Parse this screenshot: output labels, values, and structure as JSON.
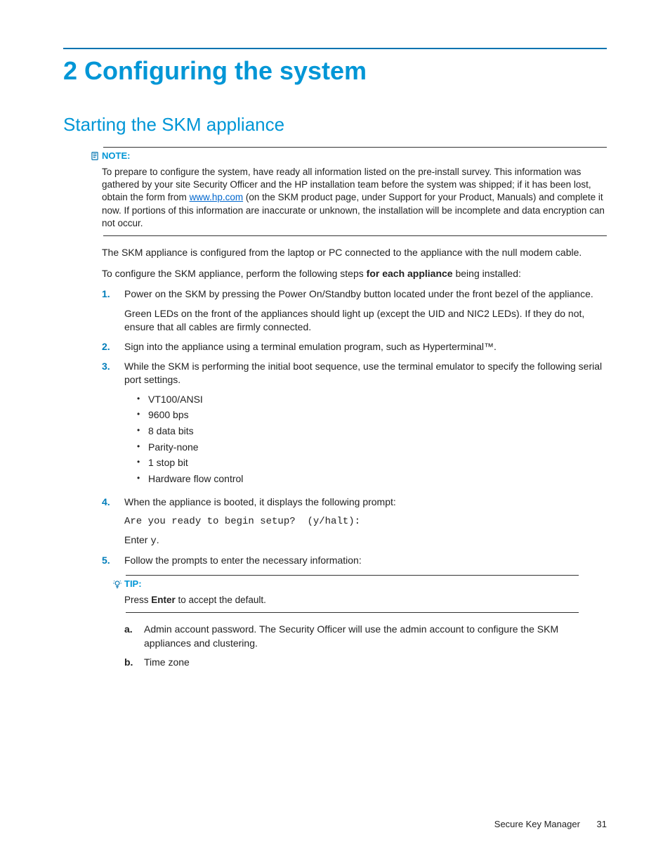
{
  "chapter": {
    "title": "2 Configuring the system"
  },
  "section": {
    "title": "Starting the SKM appliance"
  },
  "note": {
    "label": "NOTE:",
    "body_pre": "To prepare to configure the system, have ready all information listed on the pre-install survey. This information was gathered by your site Security Officer and the HP installation team before the system was shipped; if it has been lost, obtain the form from ",
    "link_text": "www.hp.com",
    "body_post": " (on the SKM product page, under Support for your Product, Manuals) and complete it now. If portions of this information are inaccurate or unknown, the installation will be incomplete and data encryption can not occur."
  },
  "intro": {
    "p1": "The SKM appliance is configured from the laptop or PC connected to the appliance with the null modem cable.",
    "p2_pre": "To configure the SKM appliance, perform the following steps ",
    "p2_bold": "for each appliance",
    "p2_post": " being installed:"
  },
  "steps": [
    {
      "num": "1.",
      "p1": "Power on the SKM by pressing the Power On/Standby button located under the front bezel of the appliance.",
      "p2": "Green LEDs on the front of the appliances should light up (except the UID and NIC2 LEDs). If they do not, ensure that all cables are firmly connected."
    },
    {
      "num": "2.",
      "p1": "Sign into the appliance using a terminal emulation program, such as Hyperterminal™."
    },
    {
      "num": "3.",
      "p1": "While the SKM is performing the initial boot sequence, use the terminal emulator to specify the following serial port settings.",
      "bullets": [
        "VT100/ANSI",
        "9600 bps",
        "8 data bits",
        "Parity-none",
        "1 stop bit",
        "Hardware flow control"
      ]
    },
    {
      "num": "4.",
      "p1": "When the appliance is booted, it displays the following prompt:",
      "code": "Are you ready to begin setup?  (y/halt):",
      "p2_pre": "Enter ",
      "p2_mono": "y",
      "p2_post": "."
    },
    {
      "num": "5.",
      "p1": "Follow the prompts to enter the necessary information:"
    }
  ],
  "tip": {
    "label": "TIP:",
    "body_pre": "Press ",
    "body_bold": "Enter",
    "body_post": " to accept the default."
  },
  "substeps": [
    {
      "num": "a.",
      "text": "Admin account password. The Security Officer will use the admin account to configure the SKM appliances and clustering."
    },
    {
      "num": "b.",
      "text": "Time zone"
    }
  ],
  "footer": {
    "doc": "Secure Key Manager",
    "page": "31"
  }
}
